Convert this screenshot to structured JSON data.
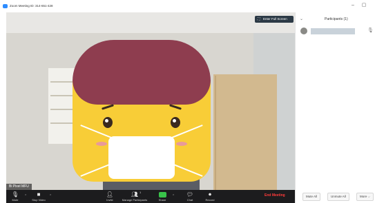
{
  "window": {
    "title": "Zoom Meeting ID: 314-651-428",
    "minimize": "–",
    "maximize": "▢"
  },
  "video": {
    "enter_full_screen": "Enter Full Screen",
    "participant_name": "Bi Pixel MFU"
  },
  "toolbar": {
    "items": [
      {
        "label": "Mute",
        "icon": "microphone-icon"
      },
      {
        "label": "Stop Video",
        "icon": "video-camera-icon"
      },
      {
        "label": "Invite",
        "icon": "invite-icon"
      },
      {
        "label": "Manage Participants",
        "icon": "participants-icon",
        "count": "1"
      },
      {
        "label": "Share",
        "icon": "share-screen-icon"
      },
      {
        "label": "Chat",
        "icon": "chat-icon"
      },
      {
        "label": "Record",
        "icon": "record-icon"
      }
    ],
    "end_meeting": "End Meeting"
  },
  "participants_panel": {
    "title": "Participants (1)",
    "buttons": {
      "mute_all": "Mute All",
      "unmute_all": "Unmute All",
      "more": "More ⌵"
    }
  },
  "colors": {
    "accent": "#2d8cff",
    "end_meeting": "#ff3b3b",
    "share": "#39c24a",
    "toolbar_bg": "#1c1c1e"
  }
}
